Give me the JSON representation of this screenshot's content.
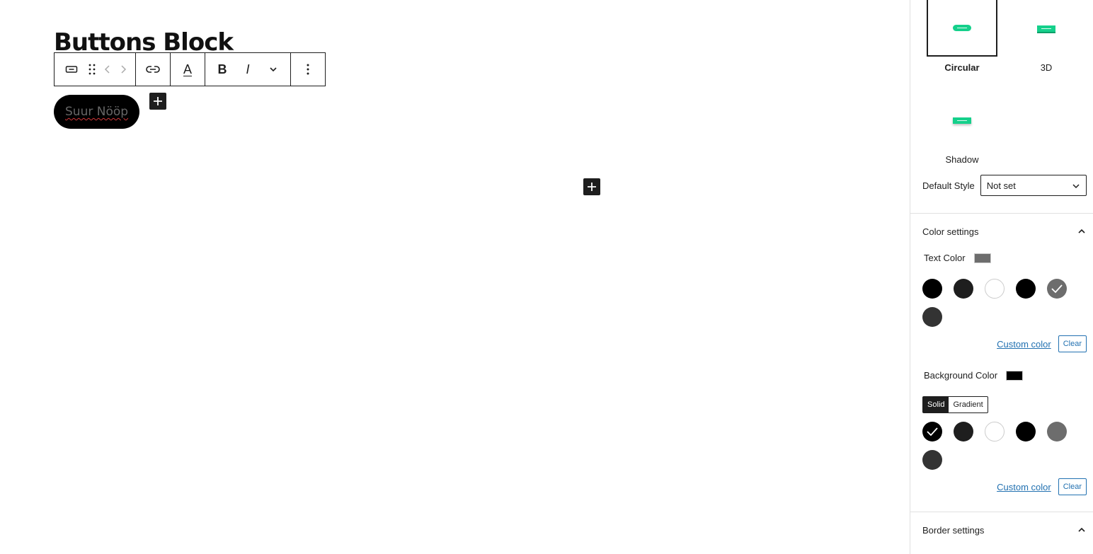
{
  "editor": {
    "title": "Buttons Block",
    "button_text": "Suur Nööp"
  },
  "toolbar": {
    "icons": [
      "button-block-icon",
      "drag-handle-icon",
      "move-left-icon",
      "move-right-icon",
      "link-icon",
      "text-color-icon",
      "bold-icon",
      "italic-icon",
      "more-formatting-icon",
      "options-icon"
    ],
    "text_color_label": "A",
    "bold_label": "B",
    "italic_label": "I"
  },
  "sidebar": {
    "styles": [
      {
        "label": "Circular",
        "selected": true
      },
      {
        "label": "3D",
        "selected": false
      },
      {
        "label": "Shadow",
        "selected": false
      }
    ],
    "default_style": {
      "label": "Default Style",
      "value": "Not set"
    },
    "color_settings": {
      "title": "Color settings",
      "text_color": {
        "label": "Text Color",
        "current": "#6d6d6d"
      },
      "text_swatches": [
        {
          "color": "#000000",
          "selected": false
        },
        {
          "color": "#1e1e1e",
          "selected": false
        },
        {
          "color": "#ffffff",
          "selected": false
        },
        {
          "color": "#000000",
          "selected": false
        },
        {
          "color": "#6d6d6d",
          "selected": true
        },
        {
          "color": "#333333",
          "selected": false
        }
      ],
      "custom_color": "Custom color",
      "clear": "Clear",
      "background_color": {
        "label": "Background Color",
        "current": "#000000"
      },
      "bg_tabs": {
        "solid": "Solid",
        "gradient": "Gradient",
        "active": "solid"
      },
      "bg_swatches": [
        {
          "color": "#000000",
          "selected": true
        },
        {
          "color": "#1e1e1e",
          "selected": false
        },
        {
          "color": "#ffffff",
          "selected": false
        },
        {
          "color": "#000000",
          "selected": false
        },
        {
          "color": "#6d6d6d",
          "selected": false
        },
        {
          "color": "#333333",
          "selected": false
        }
      ]
    },
    "border_settings": {
      "title": "Border settings"
    }
  },
  "colors": {
    "accent": "#15d08b",
    "link": "#2271b1",
    "dark": "#1e1e1e"
  }
}
